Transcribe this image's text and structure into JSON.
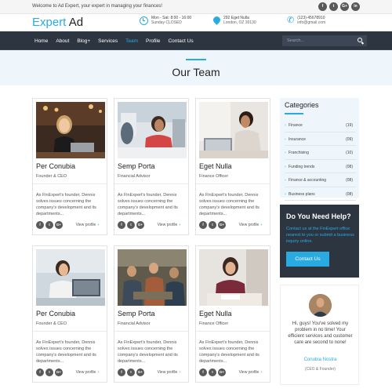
{
  "topbar": {
    "welcome": "Welcome to Ad Expert, your expert in managing your finances!",
    "socials": [
      "f",
      "t",
      "G+",
      "in"
    ]
  },
  "header": {
    "logo_a": "Expert",
    "logo_b": "Ad",
    "hours_line1": "Mon - Sat: 8:00 - 16:00",
    "hours_line2": "Sunday CLOSED",
    "address_line1": "292 Eget Nulla",
    "address_line2": "London, OZ 30130",
    "phone_line1": "(123) 45678910",
    "phone_line2": "info@gmail.com"
  },
  "nav": {
    "items": [
      "Home",
      "About",
      "Blog+",
      "Services",
      "Team",
      "Profile",
      "Contact Us"
    ],
    "active": "Team",
    "search_placeholder": "Search..."
  },
  "page": {
    "title": "Our Team"
  },
  "team": [
    {
      "name": "Per Conubia",
      "role": "Founder & CEO",
      "bio": "As FinExpert's founder, Dennis solves issues concerning the company's development and its departments...",
      "view": "View profile"
    },
    {
      "name": "Semp Porta",
      "role": "Financial Advisor",
      "bio": "As FinExpert's founder, Dennis solves issues concerning the company's development and its departments...",
      "view": "View profile"
    },
    {
      "name": "Eget Nulla",
      "role": "Finance Officer",
      "bio": "As FinExpert's founder, Dennis solves issues concerning the company's development and its departments...",
      "view": "View profile"
    },
    {
      "name": "Per Conubia",
      "role": "Founder & CEO",
      "bio": "As FinExpert's founder, Dennis solves issues concerning the company's development and its departments...",
      "view": "View profile"
    },
    {
      "name": "Semp Porta",
      "role": "Financial Advisor",
      "bio": "As FinExpert's founder, Dennis solves issues concerning the company's development and its departments...",
      "view": "View profile"
    },
    {
      "name": "Eget Nulla",
      "role": "Finance Officer",
      "bio": "As FinExpert's founder, Dennis solves issues concerning the company's development and its departments...",
      "view": "View profile"
    }
  ],
  "card_socials": [
    "f",
    "t",
    "G+"
  ],
  "categories": {
    "heading": "Categories",
    "items": [
      {
        "label": "Finance",
        "count": "(19)"
      },
      {
        "label": "Insurance",
        "count": "(09)"
      },
      {
        "label": "Franchising",
        "count": "(10)"
      },
      {
        "label": "Funding trends",
        "count": "(08)"
      },
      {
        "label": "Finance & accounting",
        "count": "(08)"
      },
      {
        "label": "Business plans",
        "count": "(08)"
      }
    ]
  },
  "help": {
    "heading": "Do You Need Help?",
    "text": "Contact us at the FinExpert office nearest to you or submit a business inquiry online.",
    "button": "Contact Us"
  },
  "testimonial": {
    "quote": "Hi, guys! You've solved my problem in no time! Your efficient services and customer care are second to none!",
    "name": "Conubia Nostra",
    "role": "(CEO & Founder)"
  },
  "colors": {
    "accent": "#29abe2",
    "dark": "#2d3540"
  }
}
